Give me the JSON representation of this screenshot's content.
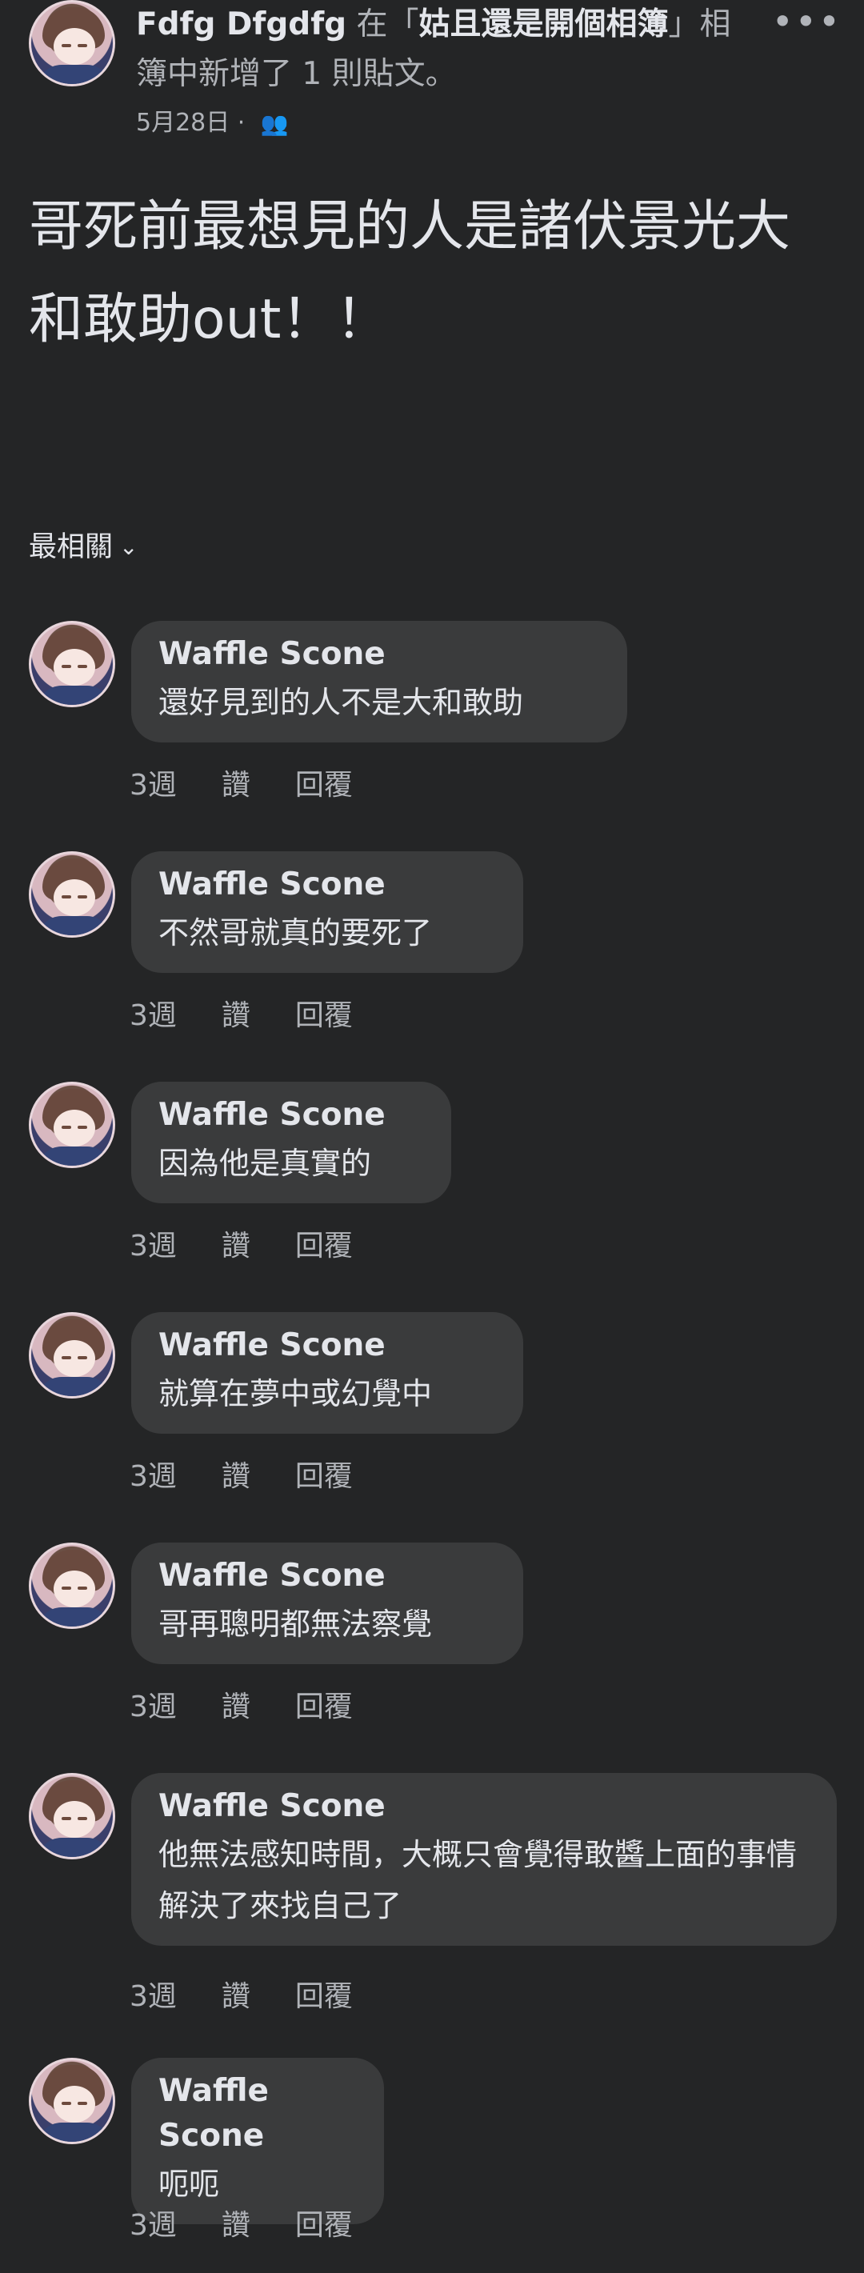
{
  "post": {
    "author": "Fdfg Dfgdfg",
    "verb_prefix": " 在「",
    "album": "姑且還是開個相簿",
    "verb_suffix": "」相簿中新增了 1 則貼文。",
    "date": "5月28日 · ",
    "privacy_icon": "friends-icon",
    "text": "哥死前最想見的人是諸伏景光大和敢助out！！"
  },
  "sort": {
    "label": "最相關",
    "icon": "chevron-down-icon"
  },
  "comments": [
    {
      "name": "Waffle Scone",
      "text": "還好見到的人不是大和敢助",
      "time": "3週",
      "like": "讚",
      "reply": "回覆"
    },
    {
      "name": "Waffle Scone",
      "text": "不然哥就真的要死了",
      "time": "3週",
      "like": "讚",
      "reply": "回覆"
    },
    {
      "name": "Waffle Scone",
      "text": "因為他是真實的",
      "time": "3週",
      "like": "讚",
      "reply": "回覆"
    },
    {
      "name": "Waffle Scone",
      "text": "就算在夢中或幻覺中",
      "time": "3週",
      "like": "讚",
      "reply": "回覆"
    },
    {
      "name": "Waffle Scone",
      "text": "哥再聰明都無法察覺",
      "time": "3週",
      "like": "讚",
      "reply": "回覆"
    },
    {
      "name": "Waffle Scone",
      "text": "他無法感知時間，大概只會覺得敢醬上面的事情解決了來找自己了",
      "time": "3週",
      "like": "讚",
      "reply": "回覆"
    },
    {
      "name": "Waffle Scone",
      "text": "呃呃",
      "time": "3週",
      "like": "讚",
      "reply": "回覆"
    }
  ],
  "colors": {
    "background": "#242526",
    "bubble": "#3a3b3c",
    "text": "#e4e6eb",
    "muted": "#b0b3b8"
  }
}
